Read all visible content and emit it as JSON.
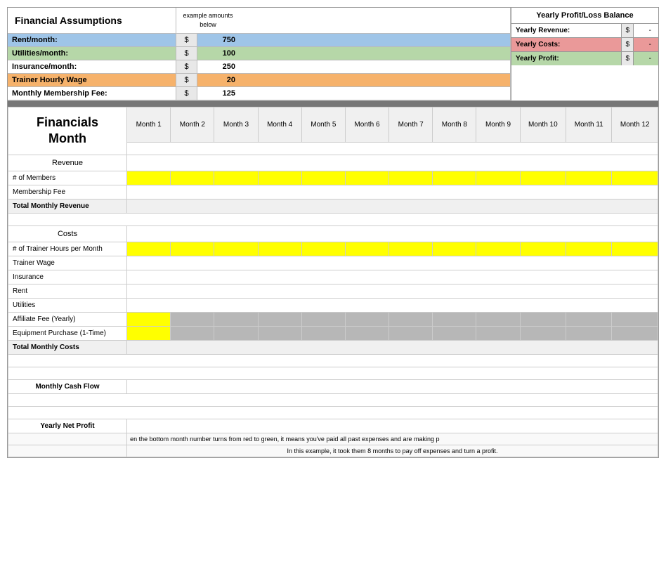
{
  "page": {
    "title": "Financial Assumptions"
  },
  "assumptions": {
    "title": "Financial Assumptions",
    "example_label": "example amounts below",
    "rows": [
      {
        "label": "Rent/month:",
        "dollar": "$",
        "value": "750",
        "bg": "bg-blue"
      },
      {
        "label": "Utilities/month:",
        "dollar": "$",
        "value": "100",
        "bg": "bg-green"
      },
      {
        "label": "Insurance/month:",
        "dollar": "$",
        "value": "250",
        "bg": ""
      },
      {
        "label": "Trainer Hourly Wage",
        "dollar": "$",
        "value": "20",
        "bg": "bg-orange"
      },
      {
        "label": "Monthly Membership Fee:",
        "dollar": "$",
        "value": "125",
        "bg": ""
      }
    ]
  },
  "yearly": {
    "title": "Yearly Profit/Loss Balance",
    "rows": [
      {
        "label": "Yearly Revenue:",
        "dollar": "$",
        "value": "-",
        "bg": ""
      },
      {
        "label": "Yearly Costs:",
        "dollar": "$",
        "value": "-",
        "bg": "bg-red"
      },
      {
        "label": "Yearly Profit:",
        "dollar": "$",
        "value": "-",
        "bg": "bg-green2"
      }
    ]
  },
  "financials": {
    "header": "Financials\nMonth",
    "months": [
      "Month 1",
      "Month 2",
      "Month 3",
      "Month 4",
      "Month 5",
      "Month 6",
      "Month 7",
      "Month 8",
      "Month 9",
      "Month 10",
      "Month 11",
      "Month 12"
    ],
    "sections": [
      {
        "label": "Revenue",
        "rows": [
          {
            "label": "# of Members",
            "type": "input-yellow"
          },
          {
            "label": "Membership Fee",
            "type": "calc-white"
          },
          {
            "label": "Total Monthly Revenue",
            "type": "total"
          }
        ]
      },
      {
        "label": "Costs",
        "rows": [
          {
            "label": "# of Trainer Hours per Month",
            "type": "input-yellow"
          },
          {
            "label": "Trainer Wage",
            "type": "calc-white"
          },
          {
            "label": "Insurance",
            "type": "calc-white"
          },
          {
            "label": "Rent",
            "type": "calc-white"
          },
          {
            "label": "Utilities",
            "type": "calc-white"
          },
          {
            "label": "Affiliate Fee (Yearly)",
            "type": "mixed-yellow-gray"
          },
          {
            "label": "Equipment Purchase (1-Time)",
            "type": "mixed-yellow1-gray"
          },
          {
            "label": "Total Monthly Costs",
            "type": "total"
          }
        ]
      }
    ],
    "extra_rows": [
      {
        "label": "",
        "type": "spacer"
      },
      {
        "label": "",
        "type": "spacer"
      },
      {
        "label": "Monthly Cash Flow",
        "type": "total"
      },
      {
        "label": "",
        "type": "spacer"
      },
      {
        "label": "",
        "type": "spacer"
      },
      {
        "label": "Yearly Net Profit",
        "type": "total"
      }
    ],
    "notes": [
      "en the bottom month number turns from red to green, it means you've paid all past expenses and are making p",
      "In this example, it took them 8 months to pay off expenses and turn a profit."
    ]
  }
}
